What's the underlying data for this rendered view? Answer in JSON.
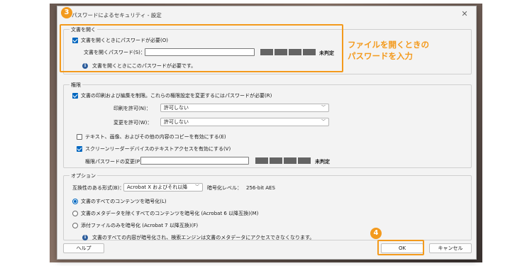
{
  "dialog": {
    "title": "パスワードによるセキュリティ - 設定",
    "close_glyph": "✕"
  },
  "open_section": {
    "title": "文書を開く",
    "require_password_label": "文書を開くときにパスワードが必要(O)",
    "require_password_checked": true,
    "password_label": "文書を開くパスワード(S)：",
    "password_value": "",
    "strength_label": "未判定",
    "info_text": "文書を開くときにこのパスワードが必要です。"
  },
  "permissions": {
    "title": "権限",
    "restrict_label": "文書の印刷および編集を制限。これらの権限設定を変更するにはパスワードが必要(R)",
    "restrict_checked": true,
    "printing_label": "印刷を許可(N)：",
    "printing_value": "許可しない",
    "changes_label": "変更を許可(W)：",
    "changes_value": "許可しない",
    "copy_label": "テキスト、画像、およびその他の内容のコピーを有効にする(E)",
    "copy_checked": false,
    "screen_reader_label": "スクリーンリーダーデバイスのテキストアクセスを有効にする(V)",
    "screen_reader_checked": true,
    "perm_password_label": "権限パスワードの変更(P)：",
    "perm_password_value": "",
    "strength_label": "未判定"
  },
  "options": {
    "title": "オプション",
    "compat_label": "互換性のある形式(B)：",
    "compat_value": "Acrobat X およびそれ以降",
    "encryption_label": "暗号化レベル：",
    "encryption_value": "256-bit AES",
    "radio_all": "文書のすべてのコンテンツを暗号化(L)",
    "radio_except_metadata": "文書のメタデータを除くすべてのコンテンツを暗号化 (Acrobat 6 以降互換)(M)",
    "radio_attachments": "添付ファイルのみを暗号化 (Acrobat 7 以降互換)(F)",
    "selected_radio": "all",
    "info_text": "文書のすべての内容が暗号化され、検索エンジンは文書のメタデータにアクセスできなくなります。"
  },
  "buttons": {
    "help": "ヘルプ",
    "ok": "OK",
    "cancel": "キャンセル"
  },
  "annotations": {
    "step3": "3",
    "step4": "4",
    "note_line1": "ファイルを開くときの",
    "note_line2": "パスワードを入力"
  },
  "colors": {
    "accent": "#f39a1d",
    "checkbox_blue": "#0067c0"
  }
}
